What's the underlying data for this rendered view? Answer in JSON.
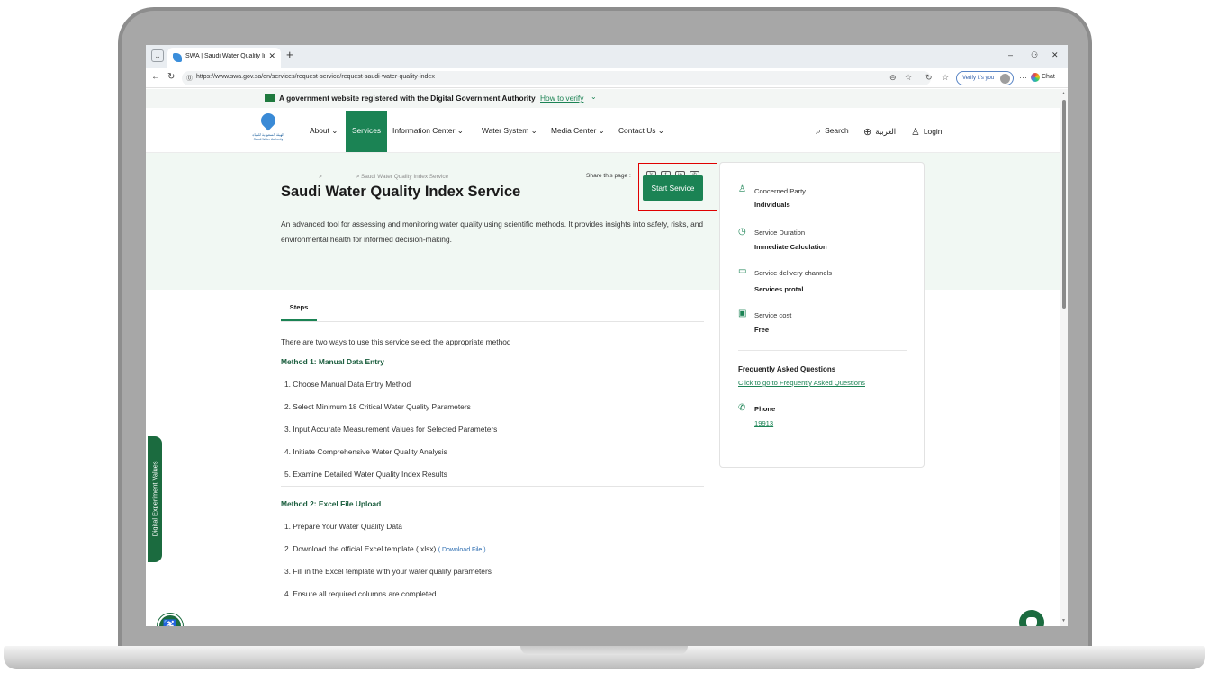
{
  "browser": {
    "tab_title": "SWA | Saudi Water Quality Index S",
    "tab_close": "✕",
    "new_tab": "+",
    "url": "https://www.swa.gov.sa/en/services/request-service/request-saudi-water-quality-index",
    "verify_label": "Verify it's you",
    "chat_label": "Chat",
    "window_min": "–",
    "window_max": "⚇",
    "window_close": "✕"
  },
  "gov_banner": {
    "text": "A government website registered with the Digital Government Authority",
    "link": "How to verify"
  },
  "logo": {
    "arabic": "الهيئة السعودية للمياه",
    "english": "Saudi Water Authority"
  },
  "nav": {
    "items": [
      "About",
      "Services",
      "Information Center",
      "Water System",
      "Media Center",
      "Contact Us"
    ],
    "search": "Search",
    "language": "العربية",
    "login": "Login"
  },
  "breadcrumb": {
    "sep": ">",
    "current": "> Saudi Water Quality Index Service"
  },
  "share": {
    "label": "Share this page :",
    "icons": [
      "x-icon",
      "facebook-icon",
      "linkedin-icon",
      "whatsapp-icon"
    ]
  },
  "service": {
    "title": "Saudi Water Quality Index Service",
    "start_button": "Start Service",
    "description": "An advanced tool for assessing and monitoring water quality using scientific methods. It provides insights into safety, risks, and environmental health for informed decision-making."
  },
  "steps": {
    "tab_label": "Steps",
    "intro": "There are two ways to use this service select the appropriate method",
    "method1_title": "Method 1: Manual Data Entry",
    "method1_steps": [
      "1. Choose Manual Data Entry Method",
      "2. Select Minimum 18 Critical Water Quality Parameters",
      "3. Input Accurate Measurement Values for Selected Parameters",
      "4. Initiate Comprehensive Water Quality Analysis",
      "5. Examine Detailed Water Quality Index Results"
    ],
    "method2_title": "Method 2: Excel File Upload",
    "method2_steps": [
      "1. Prepare Your Water Quality Data",
      "2. Download the official Excel template (.xlsx)",
      "3. Fill in the Excel template with your water quality parameters",
      "4. Ensure all required columns are completed"
    ],
    "download_link": "( Download File )"
  },
  "card": {
    "party_label": "Concerned Party",
    "party_value": "Individuals",
    "duration_label": "Service Duration",
    "duration_value": "Immediate Calculation",
    "channels_label": "Service delivery channels",
    "channels_value": "Services protal",
    "cost_label": "Service cost",
    "cost_value": "Free",
    "faq_title": "Frequently Asked Questions",
    "faq_link": "Click to go to Frequently Asked Questions",
    "phone_label": "Phone",
    "phone_value": "19913"
  },
  "side_tab": {
    "label": "Digital Experiment Values"
  },
  "colors": {
    "brand_green": "#1b8354",
    "dark_green": "#1b6b3f",
    "highlight_red": "#e00000",
    "hero_bg": "#f1f8f3"
  }
}
